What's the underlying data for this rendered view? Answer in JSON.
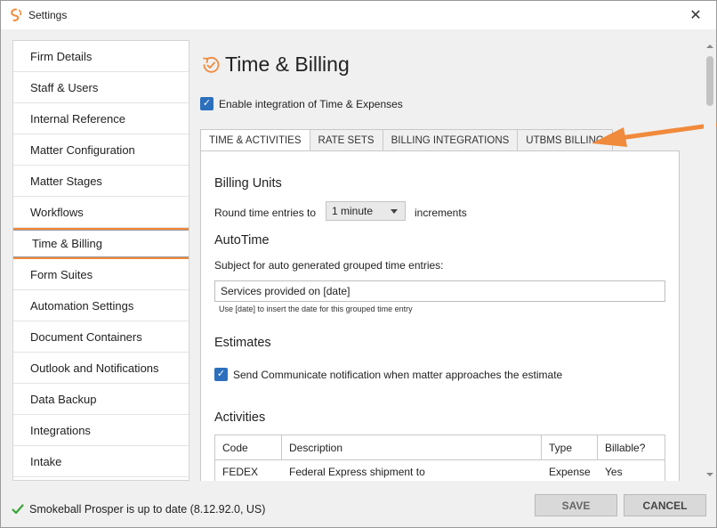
{
  "window": {
    "title": "Settings",
    "close_glyph": "✕"
  },
  "sidebar": {
    "items": [
      {
        "label": "Firm Details"
      },
      {
        "label": "Staff & Users"
      },
      {
        "label": "Internal Reference"
      },
      {
        "label": "Matter Configuration"
      },
      {
        "label": "Matter Stages"
      },
      {
        "label": "Workflows"
      },
      {
        "label": "Time & Billing",
        "selected": true
      },
      {
        "label": "Form Suites"
      },
      {
        "label": "Automation Settings"
      },
      {
        "label": "Document Containers"
      },
      {
        "label": "Outlook and Notifications"
      },
      {
        "label": "Data Backup"
      },
      {
        "label": "Integrations"
      },
      {
        "label": "Intake"
      }
    ]
  },
  "main": {
    "page_title": "Time & Billing",
    "enable_integration": {
      "label": "Enable integration of Time & Expenses",
      "checked": true
    },
    "tabs": [
      {
        "label": "TIME & ACTIVITIES",
        "active": true
      },
      {
        "label": "RATE SETS"
      },
      {
        "label": "BILLING INTEGRATIONS"
      },
      {
        "label": "UTBMS BILLING"
      }
    ],
    "billing_units": {
      "title": "Billing Units",
      "round_label": "Round time entries to",
      "round_value": "1 minute",
      "increments_label": "increments"
    },
    "autotime": {
      "title": "AutoTime",
      "subject_label": "Subject for auto generated grouped time entries:",
      "subject_value": "Services provided on [date]",
      "hint": "Use [date] to insert the date for this grouped time entry"
    },
    "estimates": {
      "title": "Estimates",
      "notify_label": "Send Communicate notification when matter approaches the estimate",
      "notify_checked": true
    },
    "activities": {
      "title": "Activities",
      "columns": [
        "Code",
        "Description",
        "Type",
        "Billable?"
      ],
      "rows": [
        [
          "FEDEX",
          "Federal Express shipment to",
          "Expense",
          "Yes"
        ]
      ]
    }
  },
  "footer": {
    "status_text": "Smokeball Prosper is up to date (8.12.92.0, US)",
    "save_label": "SAVE",
    "cancel_label": "CANCEL"
  },
  "colors": {
    "accent_orange": "#f08a3c",
    "check_blue": "#2c6fbd",
    "status_green": "#3aa535"
  }
}
